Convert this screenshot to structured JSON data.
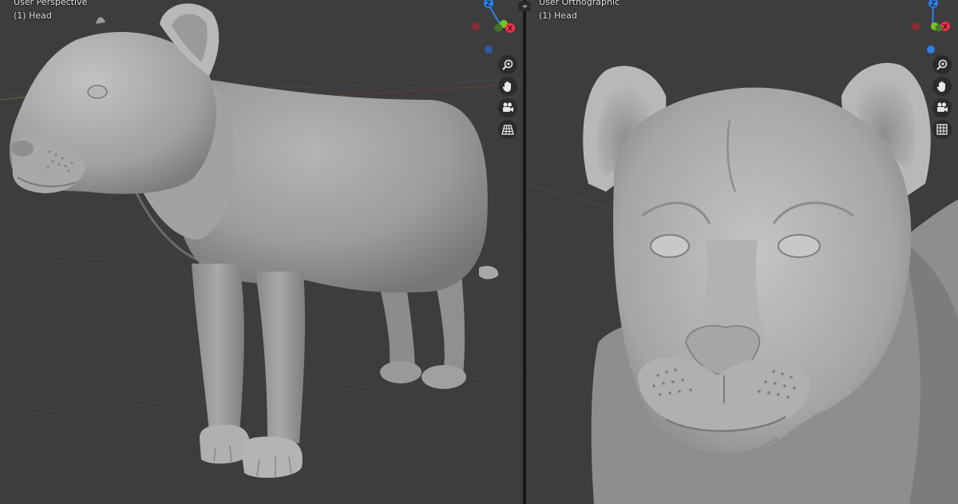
{
  "left_viewport": {
    "view_label": "User Perspective",
    "object_label": "(1) Head",
    "gizmo": {
      "z_label": "Z",
      "x_label": "X"
    }
  },
  "right_viewport": {
    "view_label": "User Orthographic",
    "object_label": "(1) Head",
    "gizmo": {
      "z_label": "Z",
      "x_label": "X"
    }
  },
  "nav_icons": [
    "zoom-icon",
    "pan-hand-icon",
    "camera-icon",
    "grid-view-icon"
  ],
  "colors": {
    "viewport_bg": "#3d3d3d",
    "axis_x": "#f0304a",
    "axis_y": "#72c624",
    "axis_z": "#2e7fe8",
    "mesh": "#9a9a9a"
  }
}
